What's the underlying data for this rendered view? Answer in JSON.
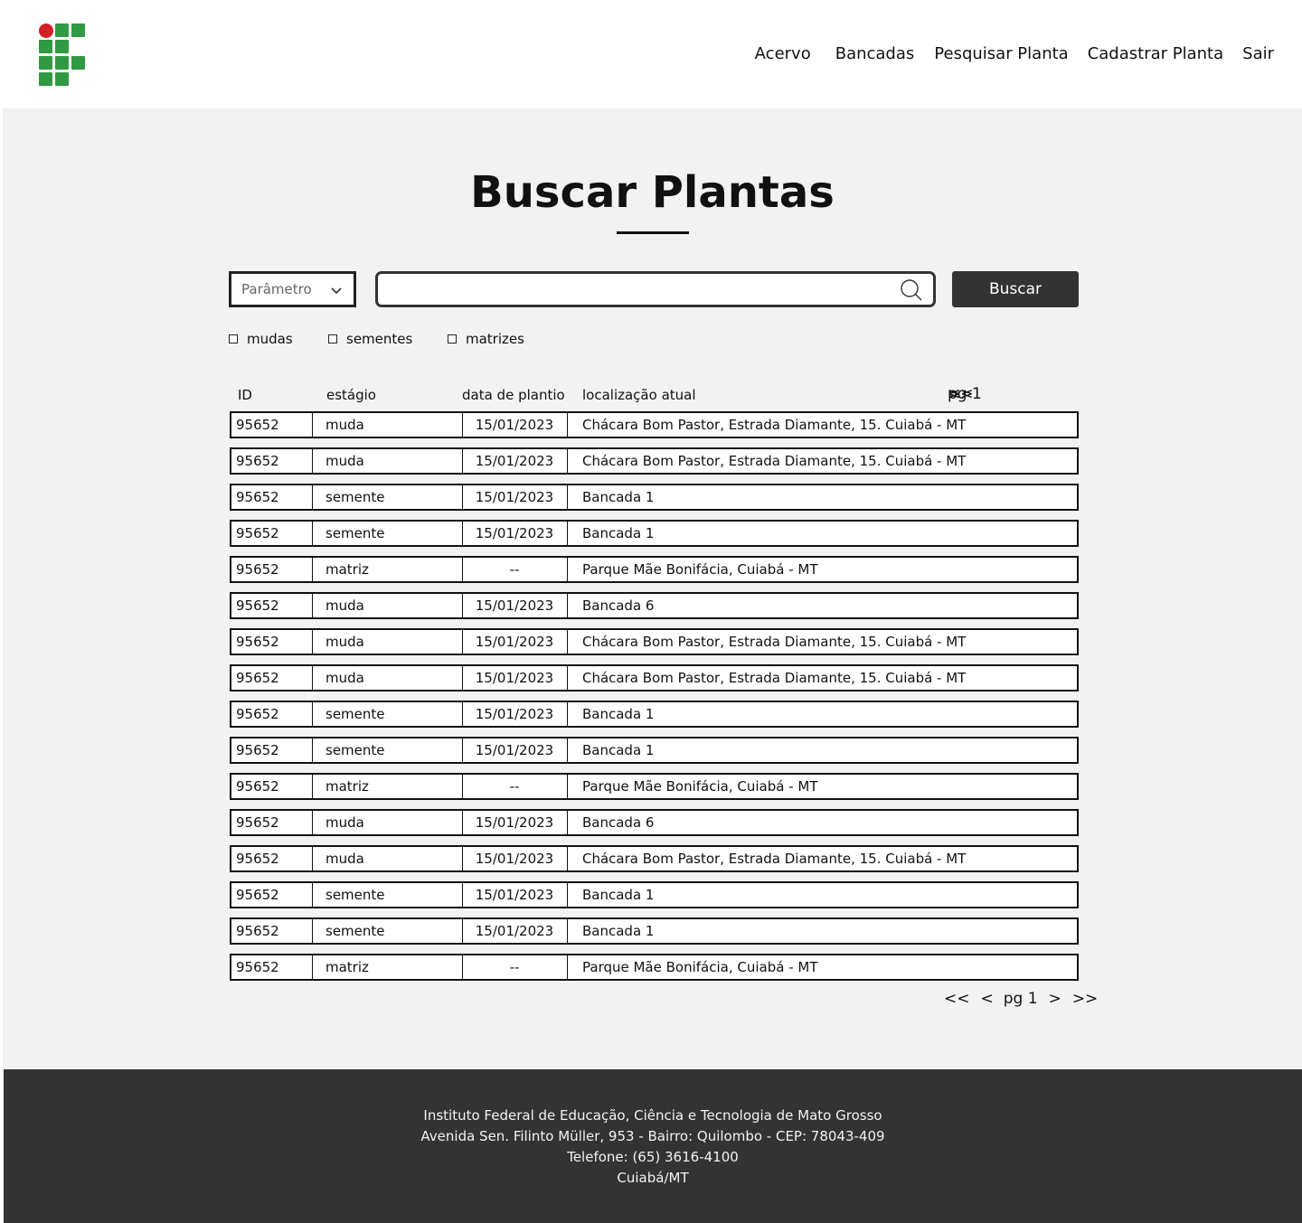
{
  "brand": {
    "logo_green": "#2f9a41",
    "logo_red": "#d32027"
  },
  "nav": {
    "items": [
      {
        "label": "Acervo"
      },
      {
        "label": "Bancadas"
      },
      {
        "label": "Pesquisar Planta"
      },
      {
        "label": "Cadastrar Planta"
      },
      {
        "label": "Sair"
      }
    ]
  },
  "page": {
    "title": "Buscar Plantas"
  },
  "search": {
    "param_label": "Parâmetro",
    "query_value": "",
    "button_label": "Buscar"
  },
  "filters": [
    {
      "label": "mudas",
      "checked": false
    },
    {
      "label": "sementes",
      "checked": false
    },
    {
      "label": "matrizes",
      "checked": false
    }
  ],
  "table": {
    "headers": [
      "ID",
      "estágio",
      "data de plantio",
      "localização atual"
    ],
    "pager": {
      "first": "<<",
      "prev": "<",
      "page": "pg 1",
      "next": ">",
      "last": ">>"
    },
    "rows": [
      [
        "95652",
        "muda",
        "15/01/2023",
        "Chácara Bom Pastor, Estrada Diamante, 15. Cuiabá - MT"
      ],
      [
        "95652",
        "muda",
        "15/01/2023",
        "Chácara Bom Pastor, Estrada Diamante, 15. Cuiabá - MT"
      ],
      [
        "95652",
        "semente",
        "15/01/2023",
        "Bancada 1"
      ],
      [
        "95652",
        "semente",
        "15/01/2023",
        "Bancada 1"
      ],
      [
        "95652",
        "matriz",
        "--",
        "Parque Mãe Bonifácia, Cuiabá - MT"
      ],
      [
        "95652",
        "muda",
        "15/01/2023",
        "Bancada 6"
      ],
      [
        "95652",
        "muda",
        "15/01/2023",
        "Chácara Bom Pastor, Estrada Diamante, 15. Cuiabá - MT"
      ],
      [
        "95652",
        "muda",
        "15/01/2023",
        "Chácara Bom Pastor, Estrada Diamante, 15. Cuiabá - MT"
      ],
      [
        "95652",
        "semente",
        "15/01/2023",
        "Bancada 1"
      ],
      [
        "95652",
        "semente",
        "15/01/2023",
        "Bancada 1"
      ],
      [
        "95652",
        "matriz",
        "--",
        "Parque Mãe Bonifácia, Cuiabá - MT"
      ],
      [
        "95652",
        "muda",
        "15/01/2023",
        "Bancada 6"
      ],
      [
        "95652",
        "muda",
        "15/01/2023",
        "Chácara Bom Pastor, Estrada Diamante, 15. Cuiabá - MT"
      ],
      [
        "95652",
        "semente",
        "15/01/2023",
        "Bancada 1"
      ],
      [
        "95652",
        "semente",
        "15/01/2023",
        "Bancada 1"
      ],
      [
        "95652",
        "matriz",
        "--",
        "Parque Mãe Bonifácia, Cuiabá - MT"
      ]
    ]
  },
  "footer": {
    "lines": [
      "Instituto Federal de Educação, Ciência e Tecnologia de Mato Grosso",
      "Avenida Sen. Filinto Müller, 953 - Bairro: Quilombo - CEP: 78043-409",
      "Telefone: (65) 3616-4100",
      "Cuiabá/MT"
    ]
  }
}
